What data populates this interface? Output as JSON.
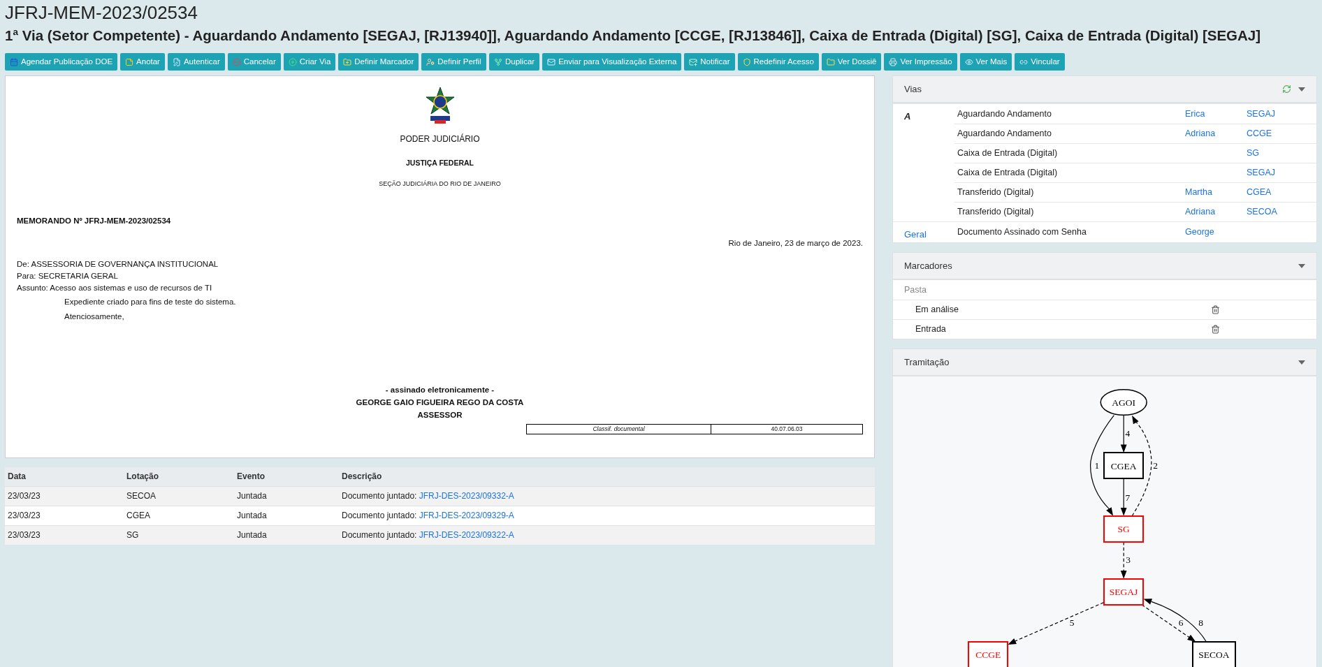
{
  "header": {
    "title": "JFRJ-MEM-2023/02534",
    "subtitle": "1ª Via (Setor Competente) - Aguardando Andamento [SEGAJ, [RJ13940]], Aguardando Andamento [CCGE, [RJ13846]], Caixa de Entrada (Digital) [SG], Caixa de Entrada (Digital) [SEGAJ]"
  },
  "toolbar": [
    "Agendar Publicação DOE",
    "Anotar",
    "Autenticar",
    "Cancelar",
    "Criar Via",
    "Definir Marcador",
    "Definir Perfil",
    "Duplicar",
    "Enviar para Visualização Externa",
    "Notificar",
    "Redefinir Acesso",
    "Ver Dossiê",
    "Ver Impressão",
    "Ver Mais",
    "Vincular"
  ],
  "document": {
    "institution": "PODER JUDICIÁRIO",
    "court": "JUSTIÇA FEDERAL",
    "section": "SEÇÃO JUDICIÁRIA DO RIO DE JANEIRO",
    "memo_number": "MEMORANDO Nº JFRJ-MEM-2023/02534",
    "date_line": "Rio de Janeiro, 23 de março de 2023.",
    "header_lines": [
      "De: ASSESSORIA DE GOVERNANÇA INSTITUCIONAL",
      "Para: SECRETARIA GERAL",
      "Assunto: Acesso aos sistemas e uso de recursos de TI"
    ],
    "body": [
      "Expediente criado para fins de teste do sistema.",
      "Atenciosamente,"
    ],
    "signature": [
      "- assinado eletronicamente -",
      "GEORGE GAIO FIGUEIRA REGO DA COSTA",
      "ASSESSOR"
    ],
    "classification": {
      "label": "Classif. documental",
      "value": "40.07.06.03"
    }
  },
  "events_table": {
    "columns": [
      "Data",
      "Lotação",
      "Evento",
      "Descrição"
    ],
    "rows": [
      {
        "date": "23/03/23",
        "unit": "SECOA",
        "event": "Juntada",
        "description": "Documento juntado:",
        "link": "JFRJ-DES-2023/09332-A"
      },
      {
        "date": "23/03/23",
        "unit": "CGEA",
        "event": "Juntada",
        "description": "Documento juntado:",
        "link": "JFRJ-DES-2023/09329-A"
      },
      {
        "date": "23/03/23",
        "unit": "SG",
        "event": "Juntada",
        "description": "Documento juntado:",
        "link": "JFRJ-DES-2023/09322-A"
      }
    ]
  },
  "vias": {
    "title": "Vias",
    "groups": [
      {
        "label": "A",
        "kind": "via",
        "rows": [
          {
            "status": "Aguardando Andamento",
            "person": "Erica",
            "unit": "SEGAJ"
          },
          {
            "status": "Aguardando Andamento",
            "person": "Adriana",
            "unit": "CCGE"
          },
          {
            "status": "Caixa de Entrada (Digital)",
            "unit": "SG"
          },
          {
            "status": "Caixa de Entrada (Digital)",
            "unit": "SEGAJ"
          },
          {
            "status": "Transferido (Digital)",
            "person": "Martha",
            "unit": "CGEA"
          },
          {
            "status": "Transferido (Digital)",
            "person": "Adriana",
            "unit": "SECOA"
          }
        ]
      },
      {
        "label": "Geral",
        "kind": "link",
        "rows": [
          {
            "status": "Documento Assinado com Senha",
            "person": "George"
          }
        ]
      }
    ]
  },
  "marcadores": {
    "title": "Marcadores",
    "group": "Pasta",
    "items": [
      "Em análise",
      "Entrada"
    ]
  },
  "tramitacao": {
    "title": "Tramitação",
    "nodes": [
      {
        "label": "AGOI",
        "kind": "ellipse",
        "color": "#000000"
      },
      {
        "label": "CGEA",
        "kind": "box",
        "color": "#000000"
      },
      {
        "label": "SG",
        "kind": "box",
        "color": "#ff0000"
      },
      {
        "label": "SEGAJ",
        "kind": "box",
        "color": "#ff0000"
      },
      {
        "label": "CCGE",
        "kind": "box",
        "color": "#ff0000"
      },
      {
        "label": "SECOA",
        "kind": "box",
        "color": "#000000"
      }
    ],
    "edges": [
      {
        "label": "1",
        "dashed": false
      },
      {
        "label": "4",
        "dashed": false
      },
      {
        "label": "2",
        "dashed": true
      },
      {
        "label": "7",
        "dashed": false
      },
      {
        "label": "3",
        "dashed": true
      },
      {
        "label": "5",
        "dashed": true
      },
      {
        "label": "6",
        "dashed": true
      },
      {
        "label": "8",
        "dashed": false
      }
    ]
  }
}
